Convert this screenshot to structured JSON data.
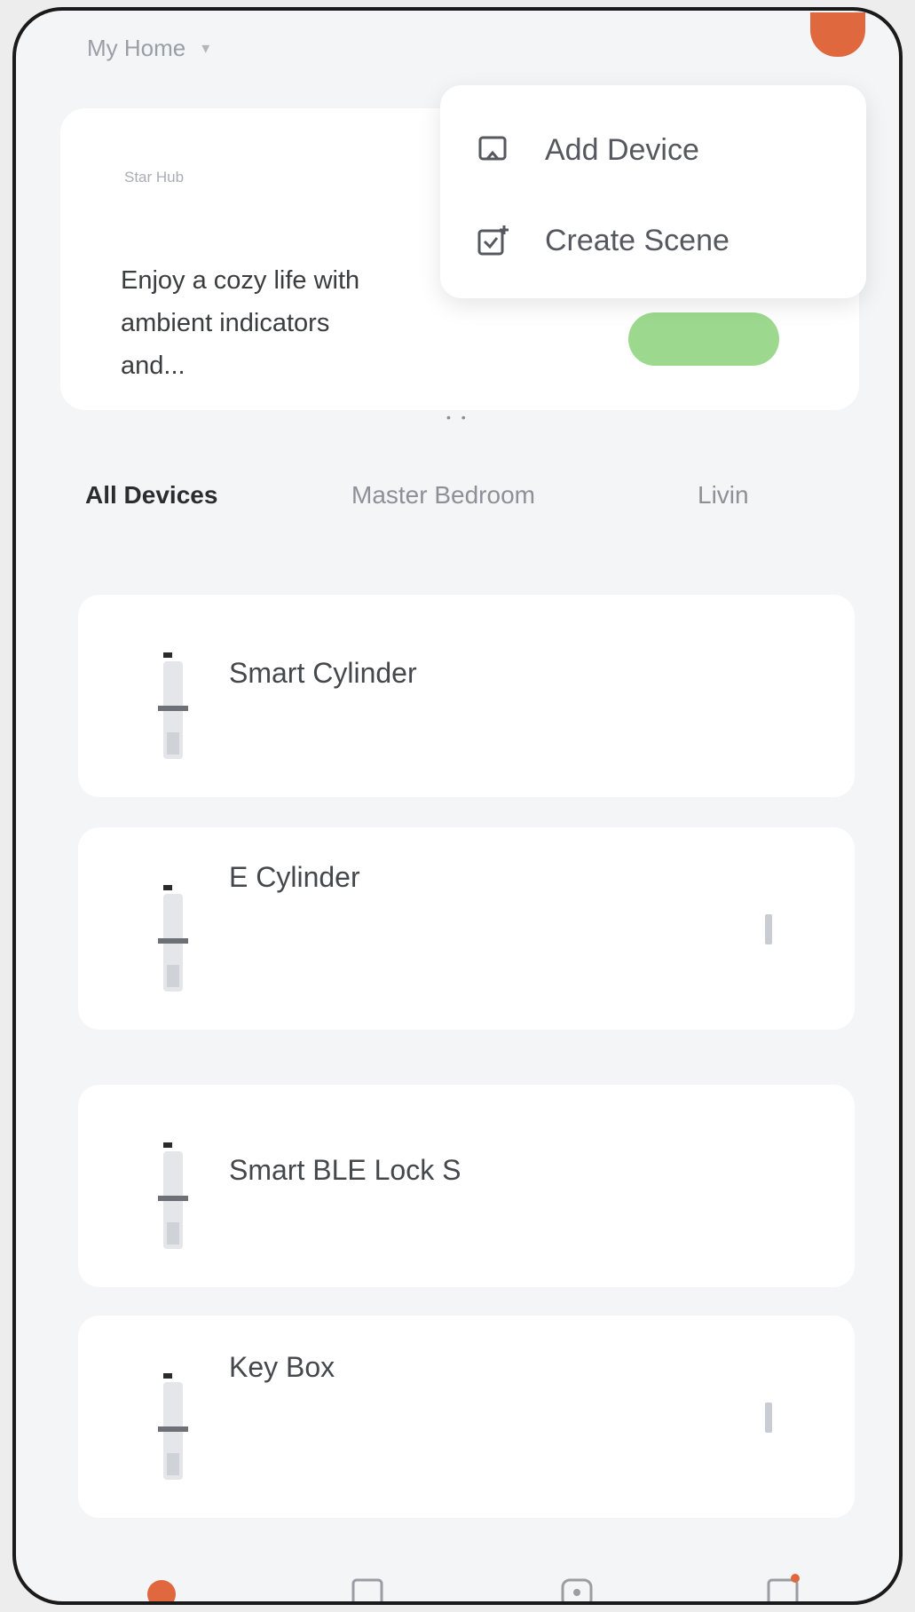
{
  "header": {
    "home_title": "My Home",
    "home_chevron": "▾"
  },
  "banner": {
    "tag": "Star Hub",
    "text": "Enjoy a cozy life with ambient indicators and...",
    "dots": "• •"
  },
  "menu": {
    "items": [
      {
        "label": "Add Device",
        "icon": "add-device-icon"
      },
      {
        "label": "Create Scene",
        "icon": "create-scene-icon"
      }
    ]
  },
  "tabs": [
    {
      "label": "All Devices",
      "active": true
    },
    {
      "label": "Master Bedroom",
      "active": false
    },
    {
      "label": "Livin",
      "active": false
    }
  ],
  "devices": [
    {
      "name": "Smart Cylinder",
      "more": false
    },
    {
      "name": "E Cylinder",
      "more": true
    },
    {
      "name": "Smart BLE Lock S",
      "more": false
    },
    {
      "name": "Key Box",
      "more": true
    }
  ],
  "bottom_nav": [
    {
      "icon": "home-icon",
      "active": true
    },
    {
      "icon": "scene-icon",
      "active": false
    },
    {
      "icon": "mall-icon",
      "active": false
    },
    {
      "icon": "profile-icon",
      "active": false
    }
  ],
  "colors": {
    "accent": "#e0683f",
    "banner_button": "#8bd27a",
    "card": "#ffffff",
    "background": "#f4f5f7"
  }
}
